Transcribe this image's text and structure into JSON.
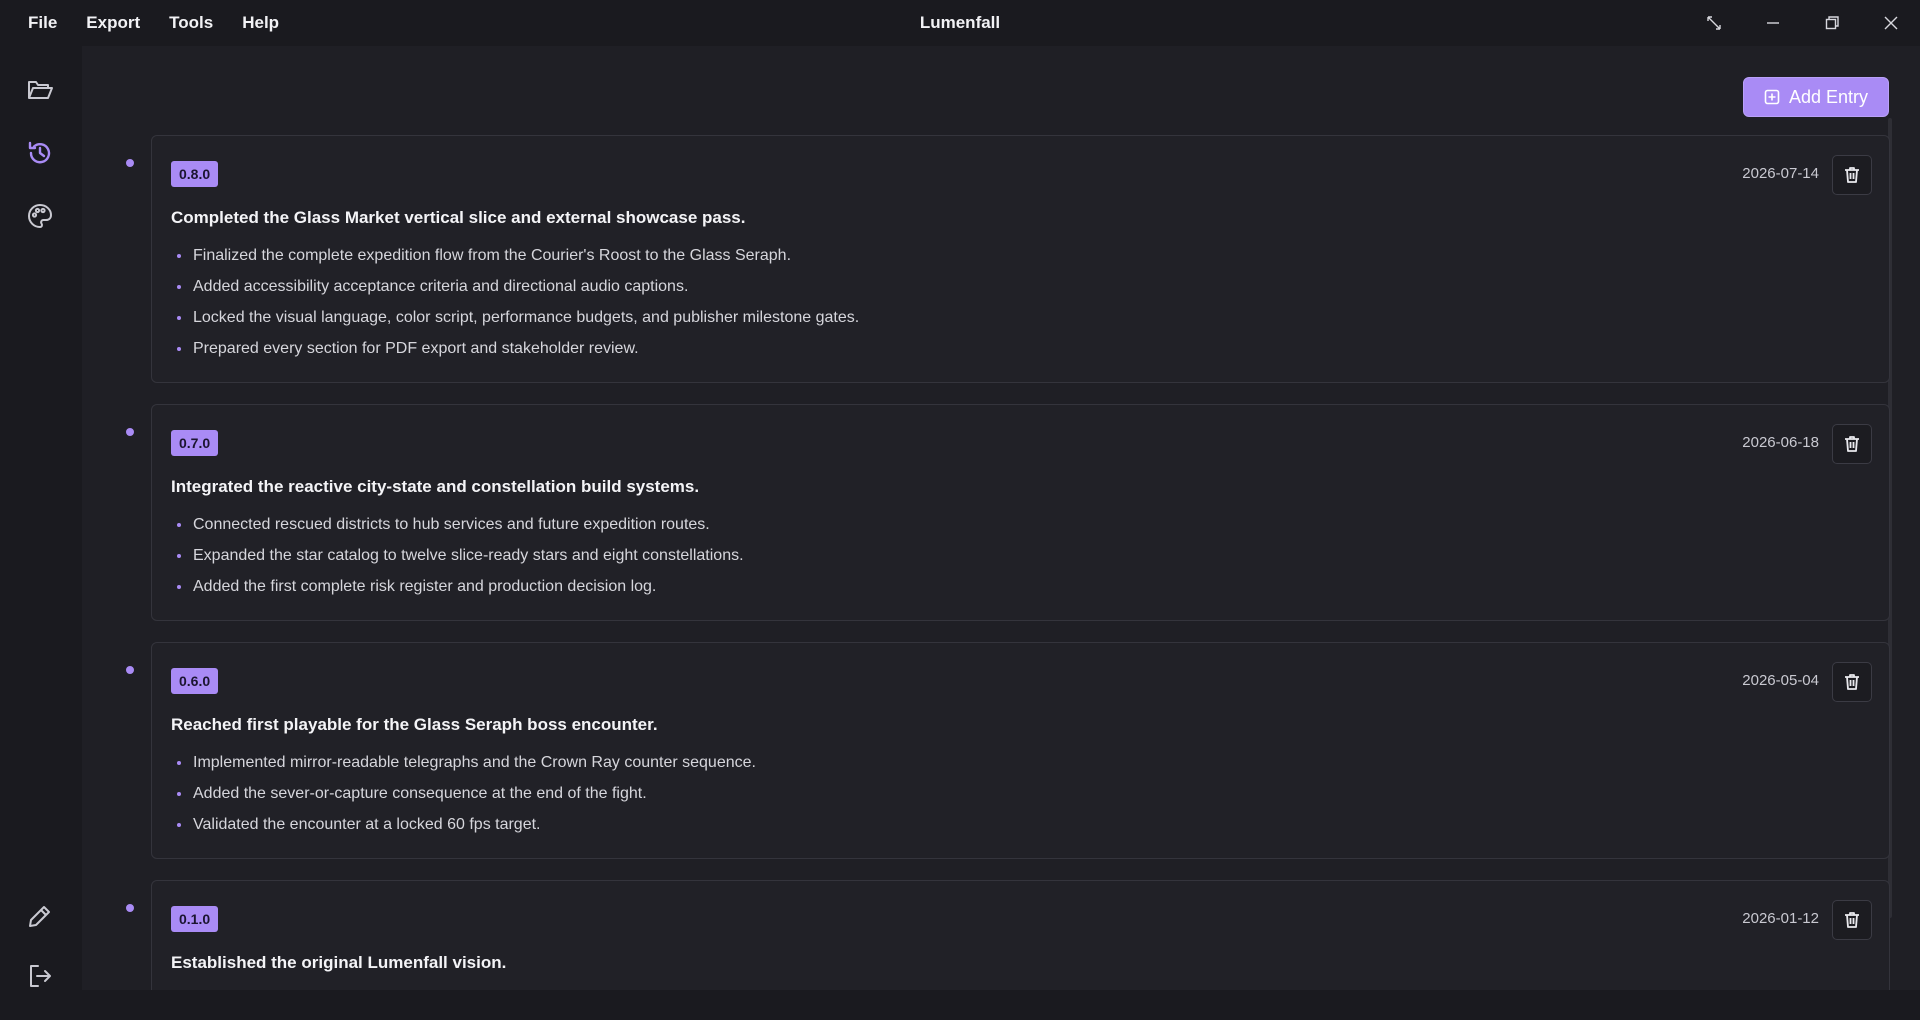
{
  "menu": {
    "items": [
      "File",
      "Export",
      "Tools",
      "Help"
    ]
  },
  "app": {
    "title": "Lumenfall"
  },
  "toolbar": {
    "add_entry_label": "Add Entry"
  },
  "colors": {
    "accent": "#a98bf5",
    "background": "#1f1f25",
    "card": "#212127",
    "titlebar": "#1a1a1f"
  },
  "icons": {
    "sidebar_top": [
      "folder-open-icon",
      "history-icon",
      "palette-icon"
    ],
    "sidebar_bottom": [
      "pencil-icon",
      "logout-icon"
    ],
    "window": [
      "fullscreen-icon",
      "minimize-icon",
      "restore-icon",
      "close-icon"
    ]
  },
  "entries": [
    {
      "version": "0.8.0",
      "date": "2026-07-14",
      "summary": "Completed the Glass Market vertical slice and external showcase pass.",
      "items": [
        "Finalized the complete expedition flow from the Courier's Roost to the Glass Seraph.",
        "Added accessibility acceptance criteria and directional audio captions.",
        "Locked the visual language, color script, performance budgets, and publisher milestone gates.",
        "Prepared every section for PDF export and stakeholder review."
      ]
    },
    {
      "version": "0.7.0",
      "date": "2026-06-18",
      "summary": "Integrated the reactive city-state and constellation build systems.",
      "items": [
        "Connected rescued districts to hub services and future expedition routes.",
        "Expanded the star catalog to twelve slice-ready stars and eight constellations.",
        "Added the first complete risk register and production decision log."
      ]
    },
    {
      "version": "0.6.0",
      "date": "2026-05-04",
      "summary": "Reached first playable for the Glass Seraph boss encounter.",
      "items": [
        "Implemented mirror-readable telegraphs and the Crown Ray counter sequence.",
        "Added the sever-or-capture consequence at the end of the fight.",
        "Validated the encounter at a locked 60 fps target."
      ]
    },
    {
      "version": "0.1.0",
      "date": "2026-01-12",
      "summary": "Established the original Lumenfall vision.",
      "items": []
    }
  ]
}
